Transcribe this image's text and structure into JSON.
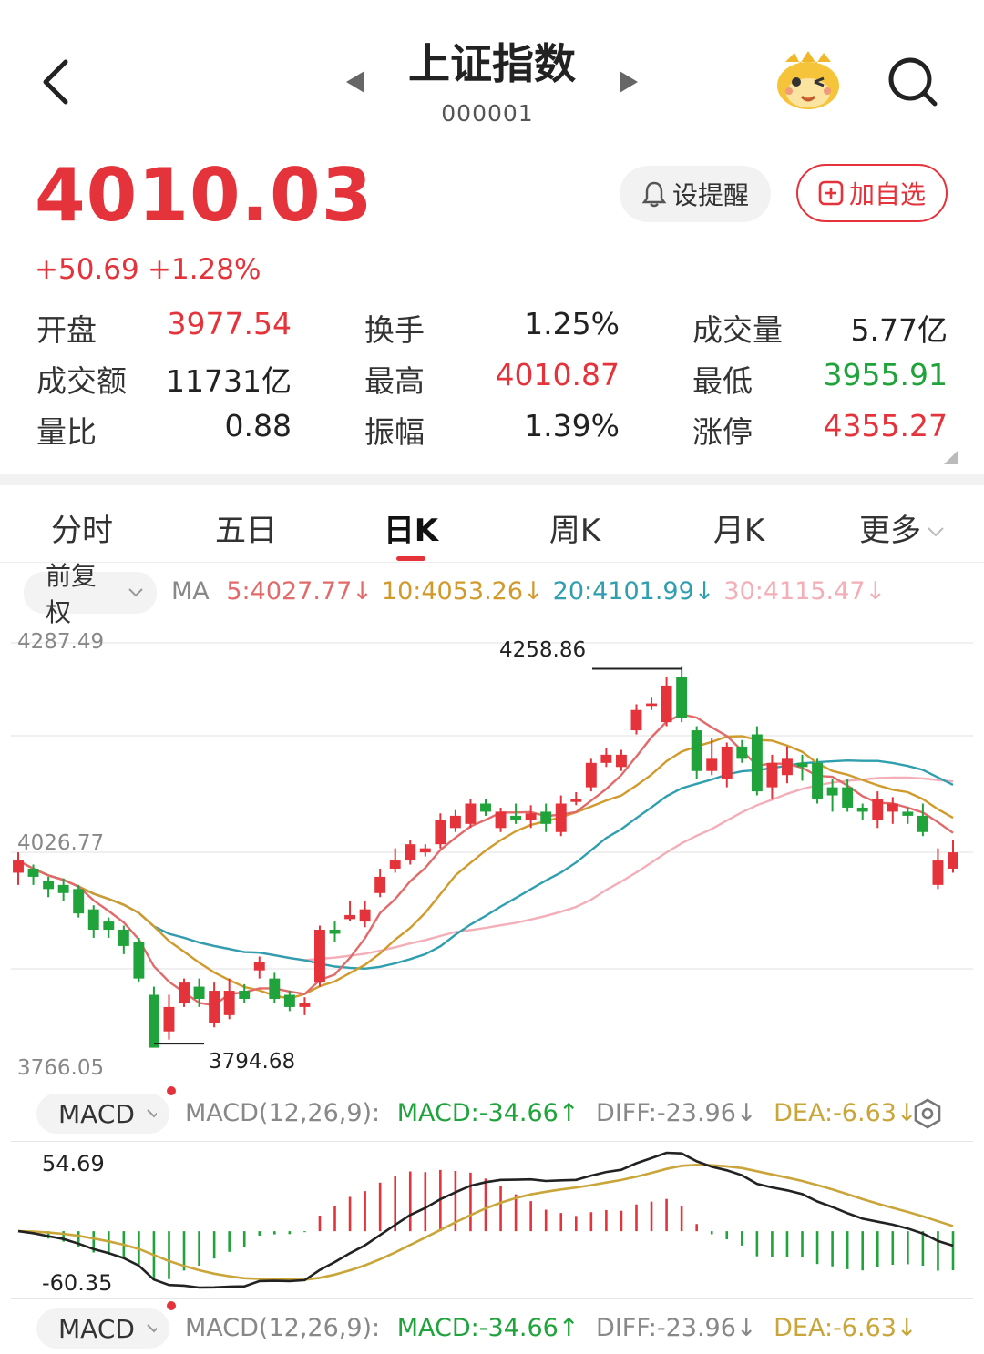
{
  "header": {
    "title": "上证指数",
    "code": "000001"
  },
  "quote": {
    "price": "4010.03",
    "change": "+50.69",
    "change_pct": "+1.28%"
  },
  "buttons": {
    "alert": "设提醒",
    "add": "加自选"
  },
  "stats": [
    {
      "label": "开盘",
      "value": "3977.54",
      "color": "#e5333b"
    },
    {
      "label": "换手",
      "value": "1.25%",
      "color": "#222222"
    },
    {
      "label": "成交量",
      "value": "5.77亿",
      "color": "#222222"
    },
    {
      "label": "成交额",
      "value": "11731亿",
      "color": "#222222"
    },
    {
      "label": "最高",
      "value": "4010.87",
      "color": "#e5333b"
    },
    {
      "label": "最低",
      "value": "3955.91",
      "color": "#1fa33a"
    },
    {
      "label": "量比",
      "value": "0.88",
      "color": "#222222"
    },
    {
      "label": "振幅",
      "value": "1.39%",
      "color": "#222222"
    },
    {
      "label": "涨停",
      "value": "4355.27",
      "color": "#e5333b"
    }
  ],
  "tabs": [
    "分时",
    "五日",
    "日K",
    "周K",
    "月K",
    "更多"
  ],
  "active_tab": "日K",
  "adjust_label": "前复权",
  "ma": {
    "label": "MA",
    "items": [
      {
        "text": "5:4027.77↓",
        "color": "#e26a6a"
      },
      {
        "text": "10:4053.26↓",
        "color": "#d19a2c"
      },
      {
        "text": "20:4101.99↓",
        "color": "#2f9fb0"
      },
      {
        "text": "30:4115.47↓",
        "color": "#f3aeb8"
      }
    ]
  },
  "kline_axis": {
    "top": "4287.49",
    "mid": "4026.77",
    "bottom": "3766.05"
  },
  "annotations": {
    "high": "4258.86",
    "low": "3794.68"
  },
  "macd_panel": {
    "selector": "MACD",
    "params": "MACD(12,26,9):",
    "macd": "MACD:-34.66↑",
    "diff": "DIFF:-23.96↓",
    "dea": "DEA:-6.63↓",
    "axis_top": "54.69",
    "axis_bottom": "-60.35"
  },
  "colors": {
    "up": "#e5333b",
    "down": "#1fa33a",
    "ma5": "#e26a6a",
    "ma10": "#d19a2c",
    "ma20": "#2f9fb0",
    "ma30": "#f3aeb8",
    "dif": "#222222",
    "dea": "#c9a53a"
  },
  "chart_data": {
    "type": "candlestick",
    "ylim": [
      3766.05,
      4287.49
    ],
    "candles": [
      [
        4005,
        4020,
        4030,
        3990
      ],
      [
        4010,
        4000,
        4015,
        3990
      ],
      [
        3995,
        3985,
        4000,
        3975
      ],
      [
        3990,
        3980,
        3998,
        3970
      ],
      [
        3985,
        3955,
        3990,
        3950
      ],
      [
        3960,
        3935,
        3965,
        3925
      ],
      [
        3945,
        3935,
        3950,
        3925
      ],
      [
        3935,
        3915,
        3940,
        3905
      ],
      [
        3920,
        3875,
        3925,
        3870
      ],
      [
        3855,
        3790,
        3865,
        3795
      ],
      [
        3810,
        3840,
        3855,
        3800
      ],
      [
        3845,
        3870,
        3875,
        3840
      ],
      [
        3865,
        3850,
        3875,
        3840
      ],
      [
        3820,
        3860,
        3870,
        3815
      ],
      [
        3830,
        3860,
        3875,
        3825
      ],
      [
        3860,
        3850,
        3868,
        3845
      ],
      [
        3885,
        3895,
        3902,
        3875
      ],
      [
        3875,
        3850,
        3882,
        3845
      ],
      [
        3855,
        3840,
        3860,
        3835
      ],
      [
        3840,
        3845,
        3852,
        3830
      ],
      [
        3870,
        3935,
        3940,
        3865
      ],
      [
        3935,
        3930,
        3945,
        3920
      ],
      [
        3948,
        3953,
        3970,
        3945
      ],
      [
        3945,
        3960,
        3970,
        3938
      ],
      [
        3980,
        4000,
        4010,
        3975
      ],
      [
        4010,
        4020,
        4035,
        4005
      ],
      [
        4020,
        4040,
        4045,
        4015
      ],
      [
        4030,
        4035,
        4040,
        4025
      ],
      [
        4040,
        4070,
        4078,
        4035
      ],
      [
        4060,
        4075,
        4082,
        4055
      ],
      [
        4065,
        4090,
        4095,
        4060
      ],
      [
        4090,
        4080,
        4095,
        4075
      ],
      [
        4060,
        4080,
        4085,
        4055
      ],
      [
        4075,
        4070,
        4090,
        4065
      ],
      [
        4070,
        4078,
        4088,
        4060
      ],
      [
        4080,
        4065,
        4090,
        4055
      ],
      [
        4055,
        4090,
        4100,
        4050
      ],
      [
        4092,
        4095,
        4104,
        4088
      ],
      [
        4110,
        4140,
        4145,
        4105
      ],
      [
        4140,
        4150,
        4158,
        4135
      ],
      [
        4135,
        4150,
        4156,
        4130
      ],
      [
        4180,
        4205,
        4212,
        4175
      ],
      [
        4210,
        4213,
        4220,
        4205
      ],
      [
        4190,
        4235,
        4245,
        4185
      ],
      [
        4245,
        4195,
        4259,
        4190
      ],
      [
        4180,
        4130,
        4185,
        4120
      ],
      [
        4130,
        4145,
        4170,
        4125
      ],
      [
        4120,
        4160,
        4165,
        4110
      ],
      [
        4160,
        4145,
        4168,
        4140
      ],
      [
        4175,
        4105,
        4185,
        4100
      ],
      [
        4110,
        4140,
        4150,
        4095
      ],
      [
        4125,
        4145,
        4160,
        4115
      ],
      [
        4140,
        4135,
        4150,
        4118
      ],
      [
        4140,
        4095,
        4145,
        4090
      ],
      [
        4110,
        4100,
        4120,
        4080
      ],
      [
        4110,
        4085,
        4120,
        4080
      ],
      [
        4085,
        4080,
        4090,
        4070
      ],
      [
        4070,
        4095,
        4105,
        4060
      ],
      [
        4080,
        4090,
        4098,
        4065
      ],
      [
        4080,
        4075,
        4085,
        4065
      ],
      [
        4075,
        4055,
        4090,
        4050
      ],
      [
        3990,
        4020,
        4035,
        3985
      ],
      [
        4010,
        4030,
        4045,
        4005
      ]
    ]
  }
}
